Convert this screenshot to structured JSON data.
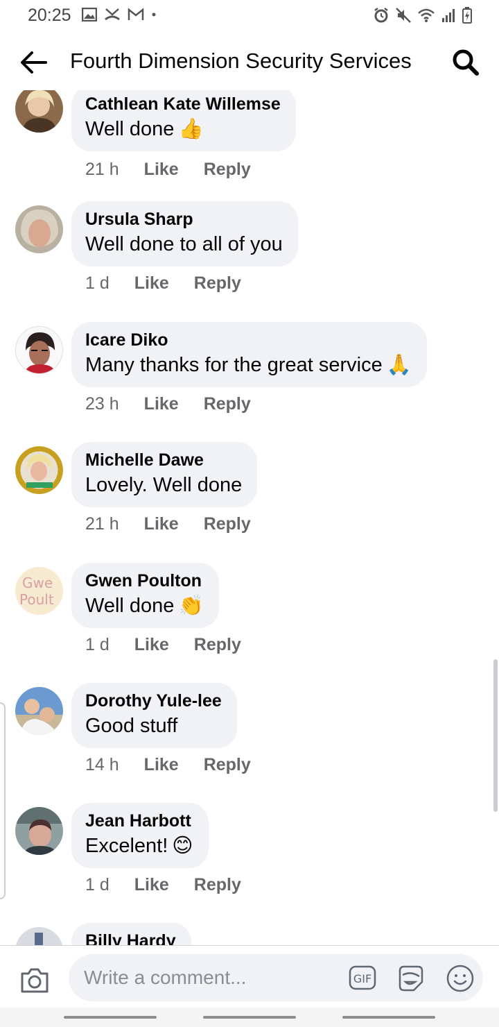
{
  "status_bar": {
    "time": "20:25",
    "left_icons": [
      "image-icon",
      "missed-call-icon",
      "gmail-icon",
      "dot-icon"
    ],
    "right_icons": [
      "alarm-icon",
      "mute-icon",
      "wifi-icon",
      "signal-icon",
      "battery-charging-icon"
    ]
  },
  "header": {
    "title": "Fourth Dimension Security Services",
    "back_icon": "arrow-left-icon",
    "search_icon": "search-icon"
  },
  "comments": [
    {
      "author": "Cathlean Kate Willemse",
      "text": "Well done",
      "emoji": "👍",
      "time": "21 h",
      "like": "Like",
      "reply": "Reply"
    },
    {
      "author": "Ursula Sharp",
      "text": "Well done to all of you",
      "emoji": "",
      "time": "1 d",
      "like": "Like",
      "reply": "Reply"
    },
    {
      "author": "Icare Diko",
      "text": "Many thanks for the great service",
      "emoji": "🙏",
      "time": "23 h",
      "like": "Like",
      "reply": "Reply"
    },
    {
      "author": "Michelle Dawe",
      "text": "Lovely. Well done",
      "emoji": "",
      "time": "21 h",
      "like": "Like",
      "reply": "Reply"
    },
    {
      "author": "Gwen Poulton",
      "text": "Well done",
      "emoji": "👏",
      "time": "1 d",
      "like": "Like",
      "reply": "Reply"
    },
    {
      "author": "Dorothy Yule-lee",
      "text": "Good stuff",
      "emoji": "",
      "time": "14 h",
      "like": "Like",
      "reply": "Reply"
    },
    {
      "author": "Jean Harbott",
      "text": "Excelent!",
      "emoji": "😊",
      "time": "1 d",
      "like": "Like",
      "reply": "Reply"
    },
    {
      "author": "Billy Hardy",
      "text": "",
      "emoji": "",
      "time": "",
      "like": "",
      "reply": ""
    }
  ],
  "composer": {
    "placeholder": "Write a comment...",
    "camera_icon": "camera-icon",
    "gif_label": "GIF",
    "sticker_icon": "sticker-icon",
    "emoji_icon": "smiley-icon"
  },
  "colors": {
    "bubble": "#f0f2f5",
    "secondary_text": "#65676b",
    "primary_text": "#050505"
  }
}
